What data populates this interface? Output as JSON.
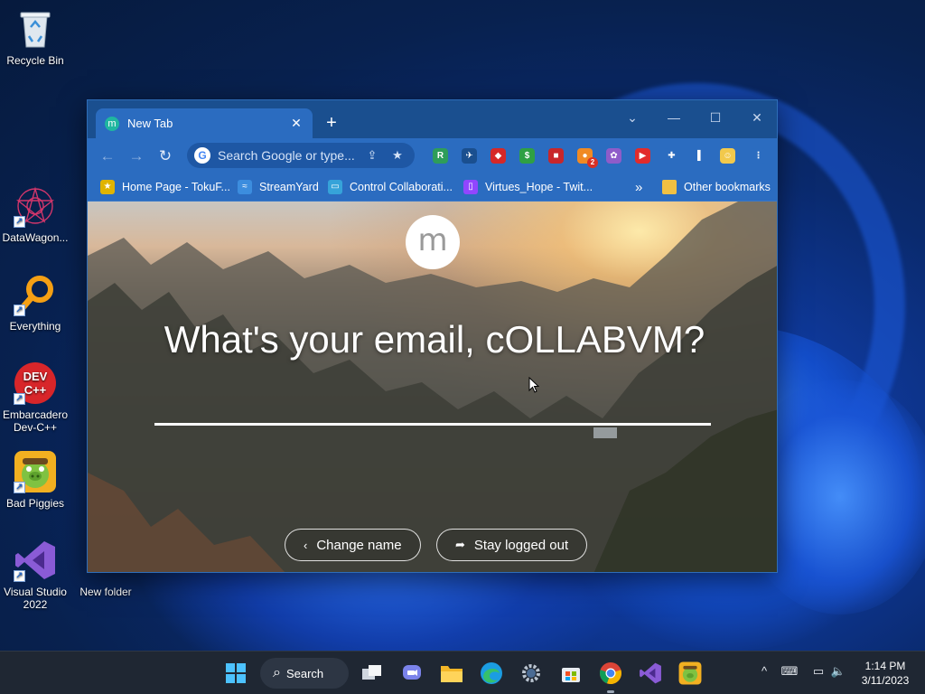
{
  "desktop": {
    "icons": [
      {
        "label": "Recycle Bin"
      },
      {
        "label": "DataWagon..."
      },
      {
        "label": "Everything"
      },
      {
        "label": "Embarcadero Dev-C++"
      },
      {
        "label": "Bad Piggies"
      },
      {
        "label": "Visual Studio 2022"
      },
      {
        "label": "New folder"
      }
    ]
  },
  "browser": {
    "tab_title": "New Tab",
    "tab_favicon": "m",
    "tab_close": "✕",
    "new_tab": "+",
    "window_controls": {
      "dropdown": "⌄",
      "minimize": "—",
      "maximize": "☐",
      "close": "✕"
    },
    "nav": {
      "back": "←",
      "forward": "→",
      "reload": "↻"
    },
    "omnibox": {
      "placeholder": "Search Google or type...",
      "google_icon": "G",
      "share_icon": "⇪",
      "star_icon": "★"
    },
    "extensions": [
      {
        "name": "extension-green-icon",
        "glyph": "R",
        "color": "#2e9d5a"
      },
      {
        "name": "extension-feather-icon",
        "glyph": "✈",
        "color": "#1a4f8f"
      },
      {
        "name": "extension-red-shield-icon",
        "glyph": "◆",
        "color": "#d62828"
      },
      {
        "name": "extension-dollar-icon",
        "glyph": "$",
        "color": "#2fa043"
      },
      {
        "name": "extension-red-square-icon",
        "glyph": "■",
        "color": "#c8262a"
      },
      {
        "name": "extension-orange-icon",
        "glyph": "●",
        "color": "#f08a24",
        "badge": "2"
      },
      {
        "name": "extension-purple-icon",
        "glyph": "✿",
        "color": "#8e5cc9"
      },
      {
        "name": "extension-youtube-icon",
        "glyph": "▶",
        "color": "#e22b2b"
      },
      {
        "name": "extensions-puzzle-icon",
        "glyph": "✚",
        "color": "#2b6cc0"
      },
      {
        "name": "side-panel-icon",
        "glyph": "▌",
        "color": "#2b6cc0"
      },
      {
        "name": "profile-avatar-icon",
        "glyph": "☺",
        "color": "#f2c94c"
      },
      {
        "name": "menu-kebab-icon",
        "glyph": "⋮",
        "color": "#2b6cc0"
      }
    ],
    "bookmarks": [
      {
        "label": "Home Page - TokuF...",
        "icon_color": "#e0b400"
      },
      {
        "label": "StreamYard",
        "icon_color": "#3c8dde"
      },
      {
        "label": "Control Collaborati...",
        "icon_color": "#36a3d9"
      },
      {
        "label": "Virtues_Hope - Twit...",
        "icon_color": "#9146ff"
      }
    ],
    "bookmarks_overflow": "»",
    "other_bookmarks": "Other bookmarks"
  },
  "page": {
    "avatar_letter": "m",
    "prompt": "What's your email, cOLLABVM?",
    "email_value": "",
    "change_name": "Change name",
    "change_name_icon": "‹",
    "stay_logged_out": "Stay logged out",
    "stay_logged_out_icon": "➦"
  },
  "taskbar": {
    "search_label": "Search",
    "search_icon": "⌕",
    "tray": {
      "chevron": "^",
      "keyboard": "⌨",
      "network": "▭",
      "volume": "🔈"
    },
    "time": "1:14 PM",
    "date": "3/11/2023"
  },
  "colors": {
    "desktop_bg": "#0a2a6e",
    "chrome_titlebar": "#1a4f8f",
    "chrome_toolbar": "#2b6cc0",
    "taskbar": "#1f2733",
    "accent": "#1fb6a0"
  }
}
